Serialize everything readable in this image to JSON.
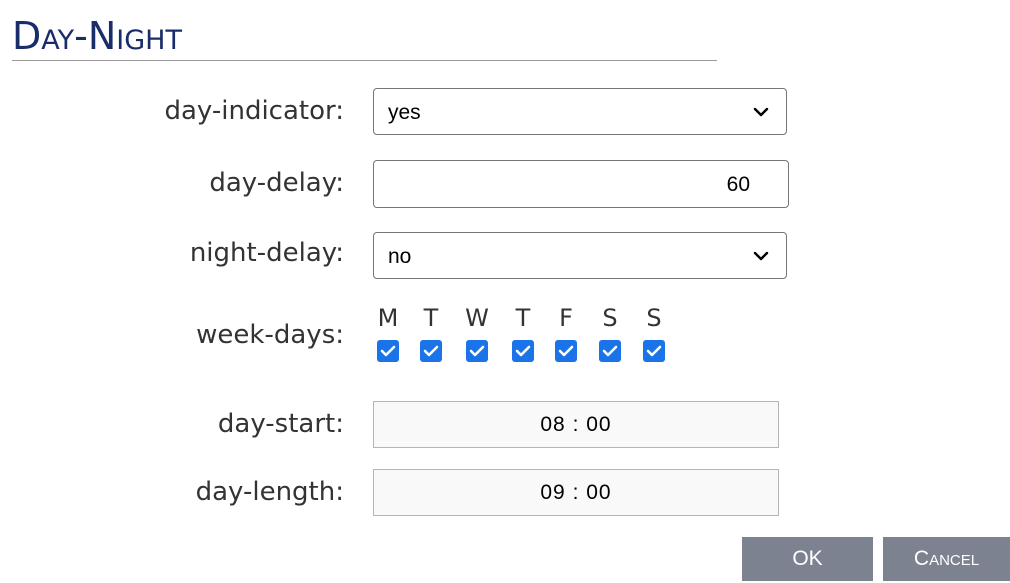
{
  "title": "Day-Night",
  "fields": {
    "day_indicator": {
      "label": "day-indicator:",
      "value": "yes"
    },
    "day_delay": {
      "label": "day-delay:",
      "value": "60"
    },
    "night_delay": {
      "label": "night-delay:",
      "value": "no"
    },
    "week_days": {
      "label": "week-days:",
      "days": [
        {
          "letter": "M",
          "checked": true
        },
        {
          "letter": "T",
          "checked": true
        },
        {
          "letter": "W",
          "checked": true
        },
        {
          "letter": "T",
          "checked": true
        },
        {
          "letter": "F",
          "checked": true
        },
        {
          "letter": "S",
          "checked": true
        },
        {
          "letter": "S",
          "checked": true
        }
      ]
    },
    "day_start": {
      "label": "day-start:",
      "value": "08 : 00"
    },
    "day_length": {
      "label": "day-length:",
      "value": "09 : 00"
    }
  },
  "buttons": {
    "ok": "OK",
    "cancel": "Cancel"
  },
  "colors": {
    "title": "#1a2d6b",
    "checkbox": "#1a73e8",
    "button_bg": "#7d8290"
  },
  "icons": {
    "select_arrow": "chevron-down-icon",
    "checkbox_mark": "checkmark-icon"
  }
}
